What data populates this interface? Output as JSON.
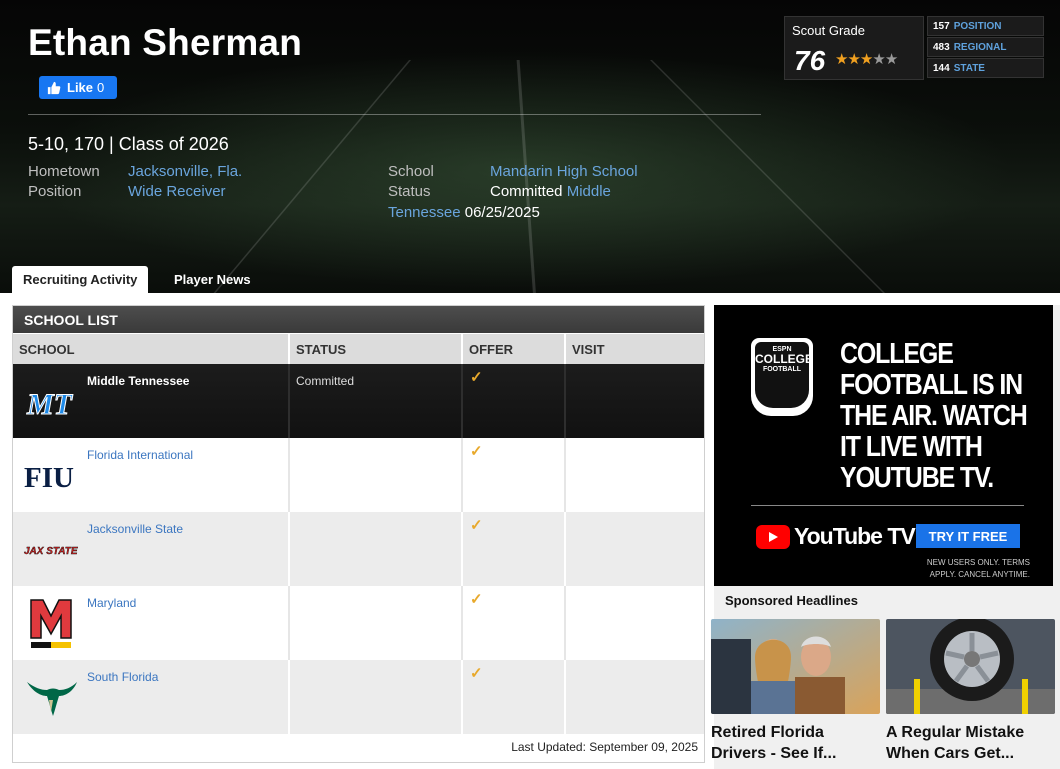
{
  "player": {
    "name": "Ethan Sherman",
    "like_label": "Like",
    "like_count": "0",
    "bio": "5-10, 170 | Class of 2026",
    "hometown_label": "Hometown",
    "hometown": "Jacksonville, Fla.",
    "position_label": "Position",
    "position": "Wide Receiver",
    "school_label": "School",
    "school": "Mandarin High School",
    "status_label": "Status",
    "status_prefix": "Committed",
    "status_school_1": "Middle",
    "status_school_2": "Tennessee",
    "status_date": "06/25/2025"
  },
  "scout": {
    "label": "Scout Grade",
    "grade": "76",
    "stars": 3,
    "stars_total": 5,
    "ranks": [
      {
        "value": "157",
        "label": "POSITION"
      },
      {
        "value": "483",
        "label": "REGIONAL"
      },
      {
        "value": "144",
        "label": "STATE"
      }
    ]
  },
  "tabs": [
    {
      "label": "Recruiting Activity",
      "active": true
    },
    {
      "label": "Player News",
      "active": false
    }
  ],
  "school_list": {
    "title": "SCHOOL LIST",
    "columns": [
      "SCHOOL",
      "STATUS",
      "OFFER",
      "VISIT"
    ],
    "rows": [
      {
        "school": "Middle Tennessee",
        "status": "Committed",
        "offer": "✓",
        "visit": "",
        "logo": "MT"
      },
      {
        "school": "Florida International",
        "status": "",
        "offer": "✓",
        "visit": "",
        "logo": "FIU"
      },
      {
        "school": "Jacksonville State",
        "status": "",
        "offer": "✓",
        "visit": "",
        "logo": "JAX STATE"
      },
      {
        "school": "Maryland",
        "status": "",
        "offer": "✓",
        "visit": "",
        "logo": "M"
      },
      {
        "school": "South Florida",
        "status": "",
        "offer": "✓",
        "visit": "",
        "logo": "usf-bull"
      }
    ],
    "last_updated": "Last Updated: September 09, 2025"
  },
  "ad": {
    "badge_top": "ESPN",
    "badge_main": "COLLEGE",
    "badge_sub": "FOOTBALL",
    "headline": "COLLEGE FOOTBALL IS IN THE AIR. WATCH IT LIVE WITH YOUTUBE TV.",
    "brand": "YouTube TV",
    "cta": "TRY IT FREE",
    "fine_print": "NEW USERS ONLY. TERMS APPLY. CANCEL ANYTIME."
  },
  "sponsored": {
    "title": "Sponsored Headlines",
    "items": [
      {
        "title": "Retired Florida Drivers - See If..."
      },
      {
        "title": "A Regular Mistake When Cars Get..."
      }
    ]
  },
  "colors": {
    "link": "#3b76c0",
    "hero_link": "#6aa5dd",
    "check": "#e8a92c",
    "facebook": "#1877f2",
    "youtube_red": "#ff0000",
    "cta_blue": "#1a73e8"
  }
}
